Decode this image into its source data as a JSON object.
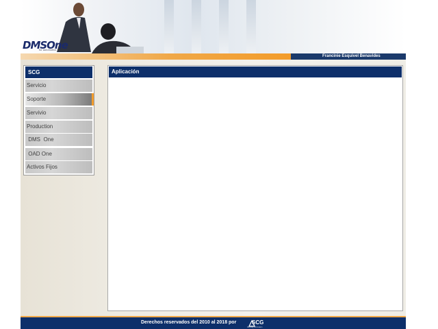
{
  "header": {
    "logo": "DMSOne",
    "logo_tagline": "for automotive",
    "user_name": "Francinie Esquivel Benavides"
  },
  "menu": {
    "title": "SCG",
    "items": [
      {
        "label": "Servicio"
      },
      {
        "label": "Soporte"
      },
      {
        "label": "Servivio"
      },
      {
        "label": "Production"
      },
      {
        "label": " DMS  One"
      },
      {
        "label": " OAD One"
      },
      {
        "label": "Activos Fijos"
      }
    ],
    "active_index": 1
  },
  "panel": {
    "title": "Aplicación"
  },
  "footer": {
    "copyright": "Derechos reservados del 2010 al 2018 por",
    "logo": "SCG",
    "logo_tagline": "Defining Information"
  },
  "colors": {
    "navy": "#0d2f6a",
    "orange": "#f39c2a"
  }
}
